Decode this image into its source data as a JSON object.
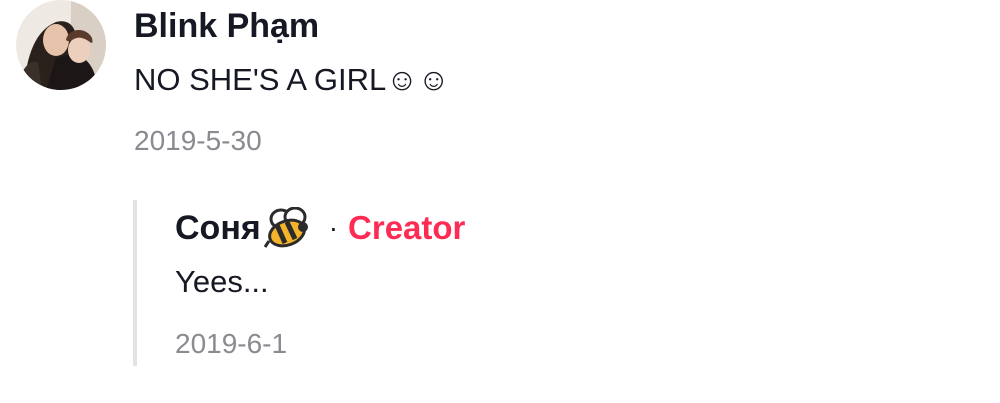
{
  "comment": {
    "username": "Blink Phạm",
    "text": "NO SHE'S A GIRL☺☺",
    "date": "2019-5-30"
  },
  "reply": {
    "username": "Соня",
    "user_emoji_icon": "bee-icon",
    "separator": "·",
    "creator_label": "Creator",
    "text": "Yees...",
    "date": "2019-6-1"
  },
  "colors": {
    "creator_accent": "#fe2c55",
    "meta_gray": "#8a8b91",
    "text_primary": "#161823",
    "reply_line": "#e3e3e4"
  }
}
